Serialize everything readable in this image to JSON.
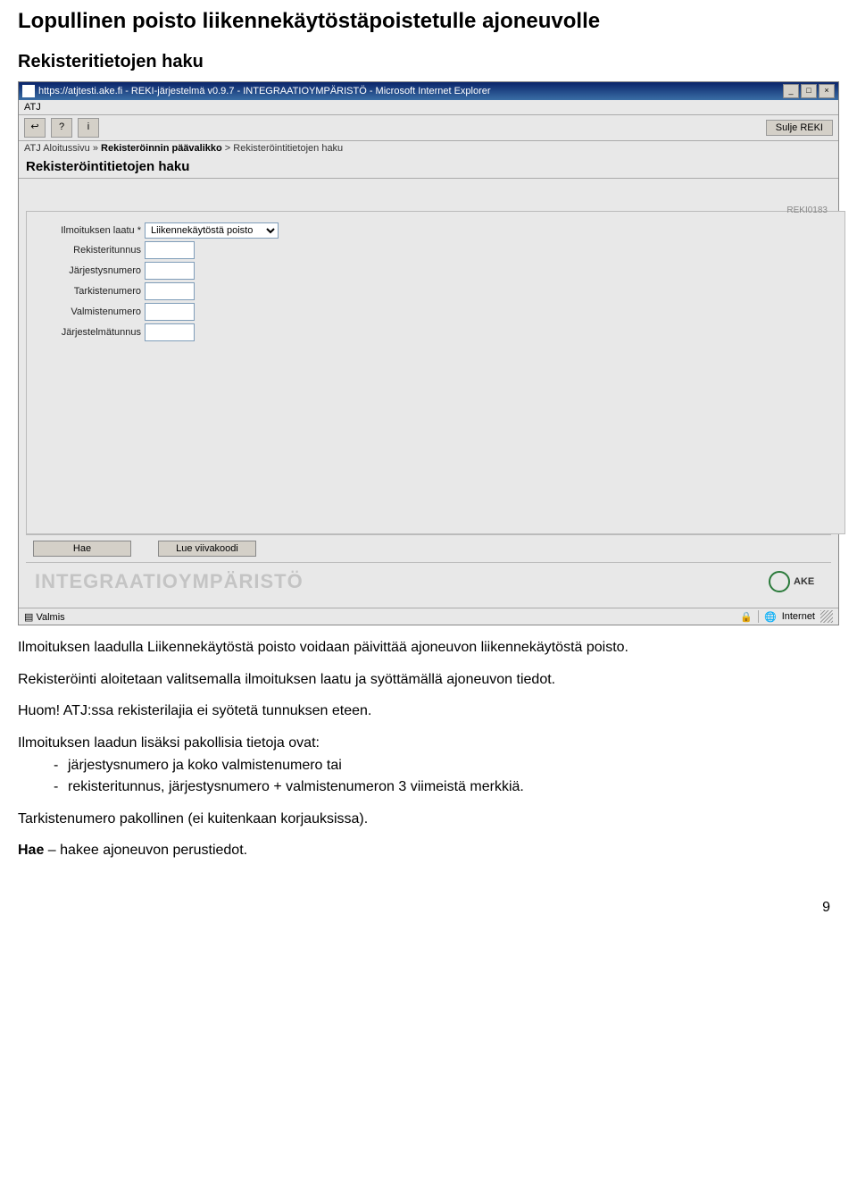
{
  "doc": {
    "title": "Lopullinen poisto liikennekäytöstäpoistetulle ajoneuvolle",
    "subtitle": "Rekisteritietojen haku",
    "p1": "Ilmoituksen laadulla Liikennekäytöstä poisto voidaan päivittää ajoneuvon liikennekäytöstä poisto.",
    "p2": "Rekisteröinti aloitetaan valitsemalla ilmoituksen laatu ja syöttämällä ajoneuvon tiedot.",
    "p3": "Huom! ATJ:ssa rekisterilajia ei syötetä tunnuksen eteen.",
    "p4": "Ilmoituksen laadun lisäksi pakollisia tietoja ovat:",
    "bullets": [
      "järjestysnumero ja koko valmistenumero tai",
      "rekisteritunnus, järjestysnumero + valmistenumeron 3 viimeistä merkkiä."
    ],
    "p5": "Tarkistenumero pakollinen (ei kuitenkaan korjauksissa).",
    "p6": "Hae – hakee ajoneuvon perustiedot.",
    "p6_bold": "Hae",
    "p6_rest": " – hakee ajoneuvon perustiedot.",
    "page_number": "9"
  },
  "window": {
    "title": "https://atjtesti.ake.fi - REKI-järjestelmä v0.9.7 - INTEGRAATIOYMPÄRISTÖ - Microsoft Internet Explorer",
    "menu": "ATJ",
    "sulje": "Sulje REKI",
    "breadcrumb": {
      "a": "ATJ Aloitussivu »",
      "b": "Rekisteröinnin päävalikko",
      "c": "> Rekisteröintitietojen haku"
    },
    "page_header": "Rekisteröintitietojen haku",
    "form_id": "REKI0183",
    "form": {
      "ilmoituksen_laatu_label": "Ilmoituksen laatu *",
      "ilmoituksen_laatu_value": "Liikennekäytöstä poisto",
      "rekisteritunnus_label": "Rekisteritunnus",
      "jarjestysnumero_label": "Järjestysnumero",
      "tarkistenumero_label": "Tarkistenumero",
      "valmistenumero_label": "Valmistenumero",
      "jarjestelmatunnus_label": "Järjestelmätunnus"
    },
    "buttons": {
      "hae": "Hae",
      "lue": "Lue viivakoodi"
    },
    "watermark": "INTEGRAATIOYMPÄRISTÖ",
    "ake": "AKE",
    "status_left": "Valmis",
    "status_right": "Internet"
  }
}
